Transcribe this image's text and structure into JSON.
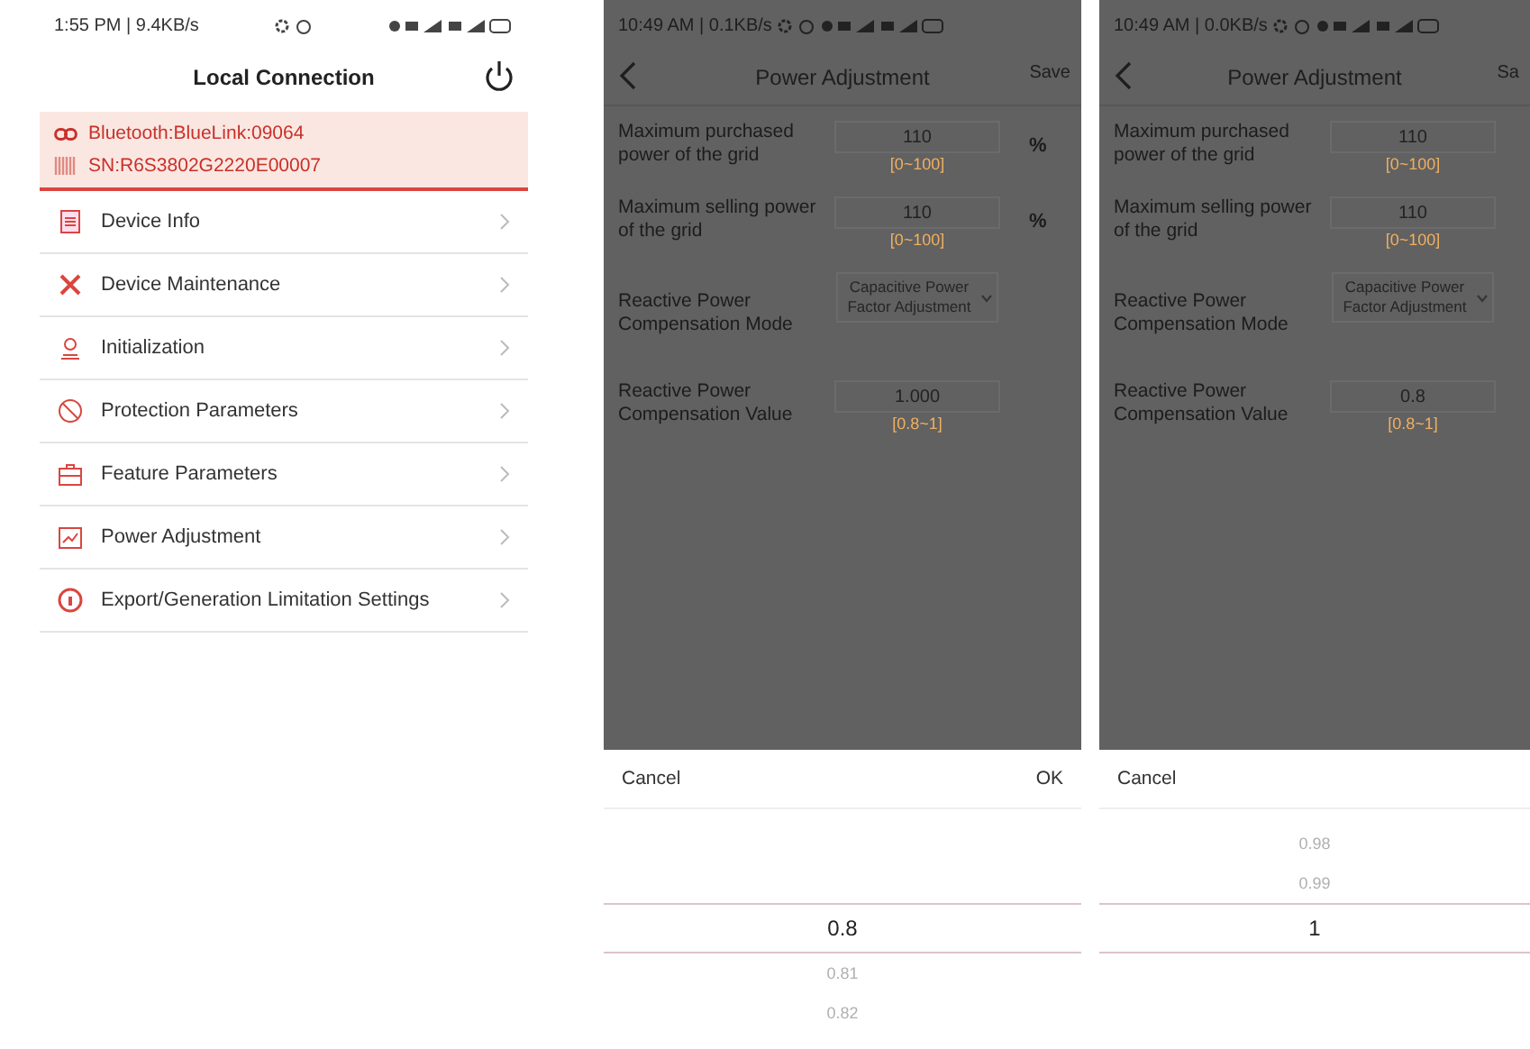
{
  "screens": [
    {
      "kind": "menu",
      "status": "1:55 PM | 9.4KB/s",
      "title": "Local Connection",
      "connection": {
        "bluetooth": "Bluetooth:BlueLink:09064",
        "serial": "SN:R6S3802G2220E00007"
      },
      "items": [
        {
          "label": "Device Info"
        },
        {
          "label": "Device Maintenance"
        },
        {
          "label": "Initialization"
        },
        {
          "label": "Protection Parameters"
        },
        {
          "label": "Feature Parameters"
        },
        {
          "label": "Power Adjustment"
        },
        {
          "label": "Export/Generation Limitation Settings"
        }
      ]
    },
    {
      "kind": "form",
      "status": "10:49 AM | 0.1KB/s",
      "title": "Power Adjustment",
      "save": "Save",
      "fields": [
        {
          "kind": "input",
          "label": "Maximum purchased power of the grid",
          "value": "110",
          "range": "[0~100]",
          "unit": "%"
        },
        {
          "kind": "input",
          "label": "Maximum selling power of the grid",
          "value": "110",
          "range": "[0~100]",
          "unit": "%"
        },
        {
          "kind": "select",
          "label": "Reactive Power Compensation Mode",
          "value": "Capacitive Power Factor Adjustment"
        },
        {
          "kind": "input",
          "label": "Reactive Power Compensation Value",
          "value": "1.000",
          "range": "[0.8~1]"
        }
      ],
      "picker": {
        "cancel": "Cancel",
        "ok": "OK",
        "items": [
          {
            "label": "0.8",
            "selected": true
          },
          {
            "label": "0.81",
            "selected": false
          },
          {
            "label": "0.82",
            "selected": false
          }
        ]
      }
    },
    {
      "kind": "form",
      "status": "10:49 AM | 0.0KB/s",
      "title": "Power Adjustment",
      "save": "Sa",
      "fields": [
        {
          "kind": "input",
          "label": "Maximum purchased power of the grid",
          "value": "110",
          "range": "[0~100]"
        },
        {
          "kind": "input",
          "label": "Maximum selling power of the grid",
          "value": "110",
          "range": "[0~100]"
        },
        {
          "kind": "select",
          "label": "Reactive Power Compensation Mode",
          "value": "Capacitive Power Factor Adjustment"
        },
        {
          "kind": "input",
          "label": "Reactive Power Compensation Value",
          "value": "0.8",
          "range": "[0.8~1]"
        }
      ],
      "picker": {
        "cancel": "Cancel",
        "items": [
          {
            "label": "0.98",
            "selected": false
          },
          {
            "label": "0.99",
            "selected": false
          },
          {
            "label": "1",
            "selected": true
          }
        ]
      }
    }
  ]
}
